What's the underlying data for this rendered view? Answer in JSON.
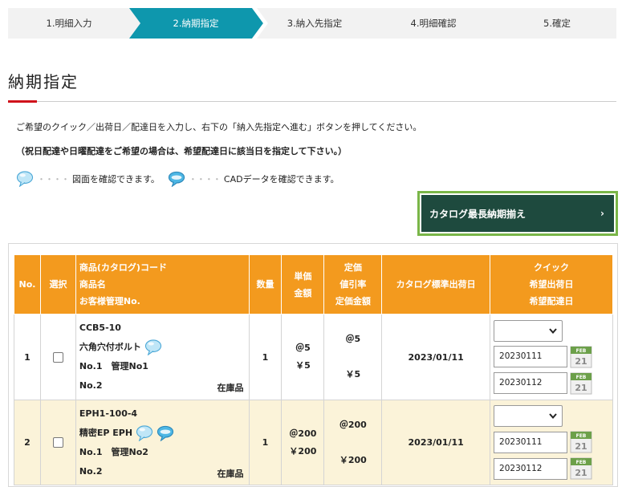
{
  "steps": [
    {
      "label": "1.明細入力",
      "active": false
    },
    {
      "label": "2.納期指定",
      "active": true
    },
    {
      "label": "3.納入先指定",
      "active": false
    },
    {
      "label": "4.明細確認",
      "active": false
    },
    {
      "label": "5.確定",
      "active": false
    }
  ],
  "colors": {
    "accent": "#0e97ad",
    "header_orange": "#f39a1e",
    "button_dark": "#1e4a3e",
    "button_border": "#7ab648",
    "title_accent": "#d0121b",
    "row_highlight": "#fbf3d9"
  },
  "page_title": "納期指定",
  "instruction": "ご希望のクイック／出荷日／配達日を入力し、右下の「納入先指定へ進む」ボタンを押してください。",
  "notice": "（祝日配達や日曜配達をご希望の場合は、希望配達日に該当日を指定して下さい。）",
  "legend": {
    "dots": "・・・・",
    "drawing_text": "図面を確認できます。",
    "cad_text": "CADデータを確認できます。"
  },
  "catalog_button": {
    "label": "カタログ最長納期揃え",
    "chevron": "›"
  },
  "table": {
    "headers": {
      "no": "No.",
      "select": "選択",
      "product": [
        "商品(カタログ)コード",
        "商品名",
        "お客様管理No."
      ],
      "qty": "数量",
      "price": [
        "単価",
        "金額"
      ],
      "list_price": [
        "定価",
        "値引率",
        "定価金額"
      ],
      "ship_date": "カタログ標準出荷日",
      "quick": [
        "クイック",
        "希望出荷日",
        "希望配達日"
      ]
    },
    "rows": [
      {
        "no": "1",
        "code": "CCB5-10",
        "name": "六角穴付ボルト",
        "mgmt1": "No.1　管理No1",
        "mgmt2": "No.2",
        "stock": "在庫品",
        "qty": "1",
        "unit_price": "＠5",
        "amount": "￥5",
        "list_price": "＠5",
        "list_amount": "￥5",
        "ship_date": "2023/01/11",
        "ship_input": "20230111",
        "delivery_input": "20230112",
        "icons": [
          "drawing-bubble"
        ]
      },
      {
        "no": "2",
        "code": "EPH1-100-4",
        "name": "精密EP EPH",
        "mgmt1": "No.1　管理No2",
        "mgmt2": "No.2",
        "stock": "在庫品",
        "qty": "1",
        "unit_price": "＠200",
        "amount": "￥200",
        "list_price": "＠200",
        "list_amount": "￥200",
        "ship_date": "2023/01/11",
        "ship_input": "20230111",
        "delivery_input": "20230112",
        "icons": [
          "drawing-bubble",
          "cad-bubble"
        ]
      }
    ],
    "calendar": {
      "month": "FEB",
      "day": "21"
    }
  }
}
